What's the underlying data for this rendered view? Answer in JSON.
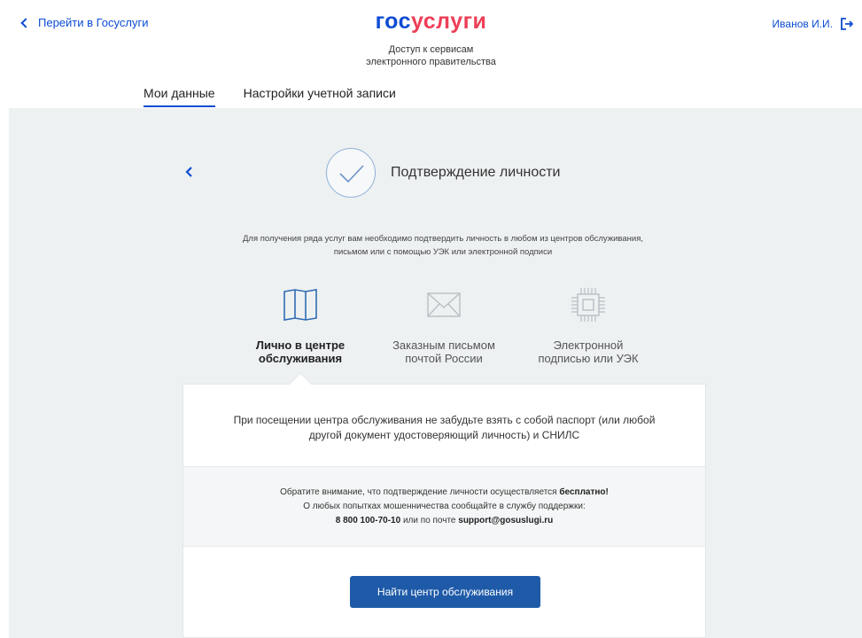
{
  "header": {
    "back_link": "Перейти в Госуслуги",
    "logo_part1": "гос",
    "logo_part2": "услуги",
    "subtitle_line1": "Доступ к сервисам",
    "subtitle_line2": "электронного правительства",
    "user_name": "Иванов И.И."
  },
  "tabs": [
    {
      "label": "Мои данные",
      "active": true
    },
    {
      "label": "Настройки учетной записи",
      "active": false
    }
  ],
  "main": {
    "title": "Подтверждение личности",
    "intro_line1": "Для получения ряда услуг вам необходимо подтвердить личность в любом из центров обслуживания,",
    "intro_line2": "письмом или с помощью УЭК или электронной подписи",
    "options": [
      {
        "line1": "Лично в центре",
        "line2": "обслуживания",
        "icon": "book-map-icon",
        "active": true
      },
      {
        "line1": "Заказным письмом",
        "line2": "почтой России",
        "icon": "envelope-icon",
        "active": false
      },
      {
        "line1": "Электронной",
        "line2": "подписью или УЭК",
        "icon": "chip-icon",
        "active": false
      }
    ],
    "card": {
      "reminder_line1": "При посещении центра обслуживания не забудьте взять с собой паспорт (или любой",
      "reminder_line2": "другой документ удостоверяющий личность) и СНИЛС",
      "notice_text": "Обратите внимание, что подтверждение личности осуществляется",
      "notice_free": "бесплатно!",
      "notice_line2": "О любых попытках мошенничества сообщайте в службу поддержки:",
      "phone": "8 800 100-70-10",
      "or_mail": "или по почте",
      "email": "support@gosuslugi.ru",
      "button": "Найти центр обслуживания"
    }
  },
  "colors": {
    "brand_blue": "#0d4cd3",
    "brand_red": "#ee3f58",
    "button_blue": "#1e5aa8",
    "background_grey": "#eef1f2"
  }
}
